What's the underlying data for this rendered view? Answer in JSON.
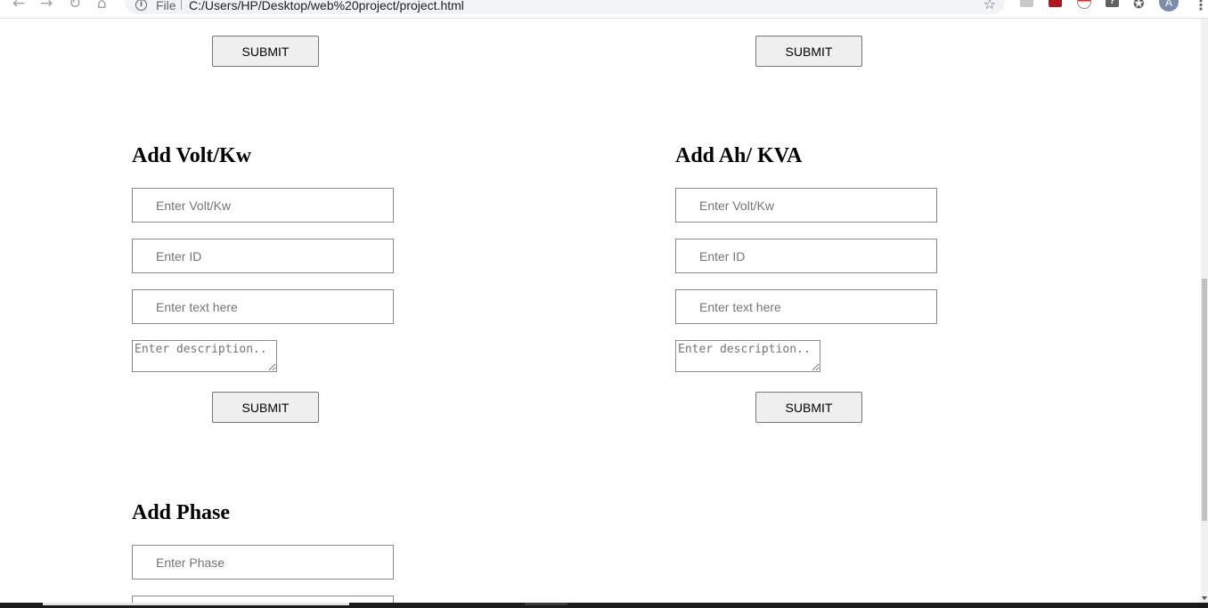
{
  "browser": {
    "scheme": "File",
    "url": "C:/Users/HP/Desktop/web%20project/project.html",
    "avatar_letter": "A",
    "icons": [
      "back-arrow-icon",
      "forward-arrow-icon",
      "reload-icon",
      "home-icon",
      "info-icon",
      "bookmark-star-icon",
      "pdf-extension-icon",
      "pdf-extension-red-icon",
      "pokeball-extension-icon",
      "help-extension-icon",
      "extensions-puzzle-icon",
      "menu-kebab-icon"
    ]
  },
  "top_row": {
    "left_submit": "SUBMIT",
    "right_submit": "SUBMIT"
  },
  "volt_form": {
    "title": "Add Volt/Kw",
    "field1_placeholder": "Enter Volt/Kw",
    "field2_placeholder": "Enter ID",
    "field3_placeholder": "Enter text here",
    "description_placeholder": "Enter description..",
    "submit": "SUBMIT"
  },
  "ah_form": {
    "title": "Add Ah/ KVA",
    "field1_placeholder": "Enter Volt/Kw",
    "field2_placeholder": "Enter ID",
    "field3_placeholder": "Enter text here",
    "description_placeholder": "Enter description..",
    "submit": "SUBMIT"
  },
  "phase_form": {
    "title": "Add Phase",
    "field1_placeholder": "Enter Phase"
  },
  "colors": {
    "page_background": "#ffffff",
    "button_background": "#efefef",
    "input_border": "#8a8a8a",
    "omnibox": "#f1f3f4"
  }
}
